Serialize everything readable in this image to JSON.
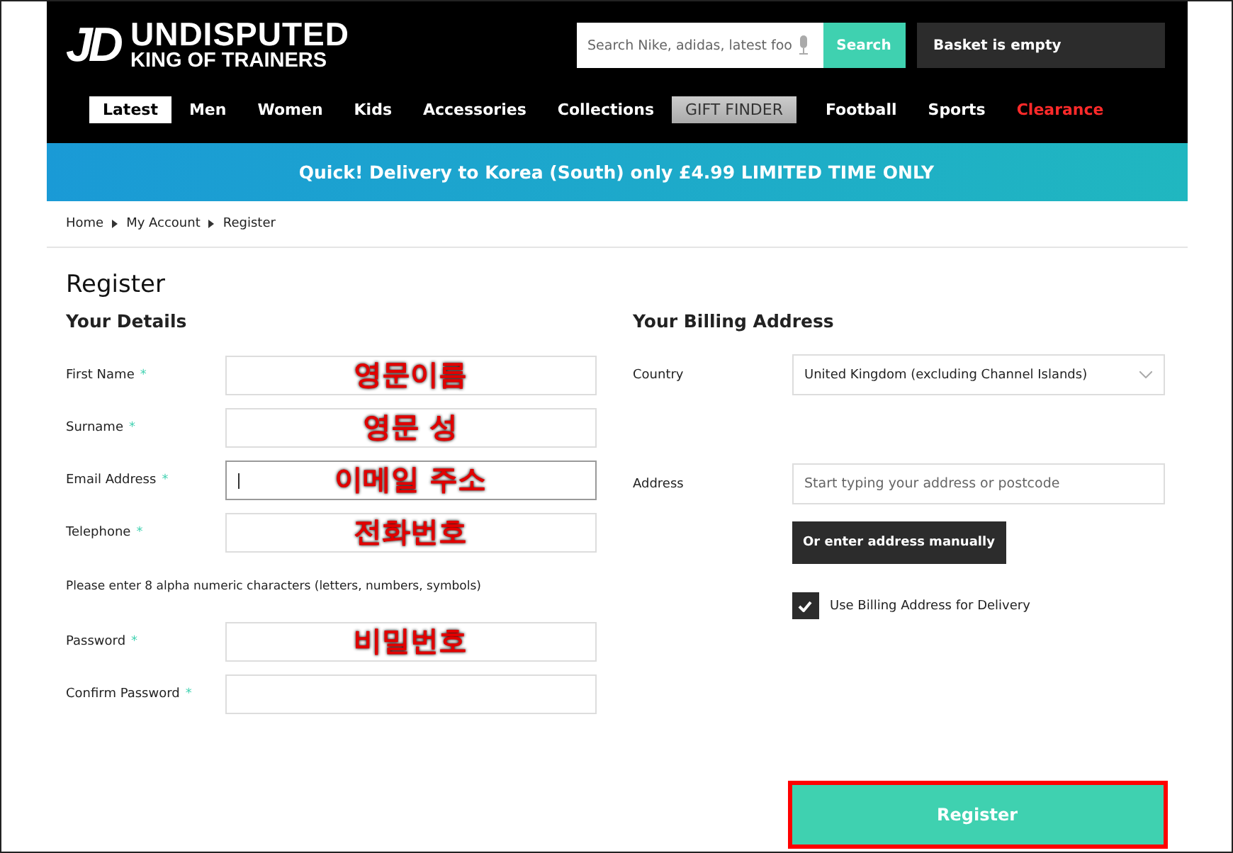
{
  "header": {
    "logo": {
      "mark": "JD",
      "line_1": "UNDISPUTED",
      "line_2": "KING OF TRAINERS"
    },
    "search": {
      "placeholder": "Search Nike, adidas, latest foo",
      "button": "Search"
    },
    "basket": "Basket is empty"
  },
  "nav": [
    {
      "label": "Latest",
      "selected": true,
      "kind": "plain"
    },
    {
      "label": "Men",
      "selected": false,
      "kind": "plain"
    },
    {
      "label": "Women",
      "selected": false,
      "kind": "plain"
    },
    {
      "label": "Kids",
      "selected": false,
      "kind": "plain"
    },
    {
      "label": "Accessories",
      "selected": false,
      "kind": "plain"
    },
    {
      "label": "Collections",
      "selected": false,
      "kind": "plain"
    },
    {
      "label": "GIFT FINDER",
      "selected": false,
      "kind": "gift"
    },
    {
      "label": "Football",
      "selected": false,
      "kind": "plain"
    },
    {
      "label": "Sports",
      "selected": false,
      "kind": "plain"
    },
    {
      "label": "Clearance",
      "selected": false,
      "kind": "sale"
    }
  ],
  "banner": "Quick! Delivery to Korea (South) only £4.99 LIMITED TIME ONLY",
  "breadcrumb": [
    "Home",
    "My Account",
    "Register"
  ],
  "title": "Register",
  "details": {
    "heading": "Your Details",
    "fields": [
      {
        "kind": "field",
        "label": "First Name",
        "required_mark": "*",
        "annotation": "영문이름",
        "focused": false
      },
      {
        "kind": "field",
        "label": "Surname",
        "required_mark": "*",
        "annotation": "영문 성",
        "focused": false
      },
      {
        "kind": "field",
        "label": "Email Address",
        "required_mark": "*",
        "annotation": "이메일 주소",
        "focused": true
      },
      {
        "kind": "field",
        "label": "Telephone",
        "required_mark": "*",
        "annotation": "전화번호",
        "focused": false
      },
      {
        "kind": "note",
        "text": "Please enter 8 alpha numeric characters (letters, numbers, symbols)"
      },
      {
        "kind": "field",
        "label": "Password",
        "required_mark": "*",
        "annotation": "비밀번호",
        "focused": false
      },
      {
        "kind": "field",
        "label": "Confirm Password",
        "required_mark": "*",
        "focused": false
      }
    ]
  },
  "billing": {
    "heading": "Your Billing Address",
    "country": {
      "label": "Country",
      "value": "United Kingdom (excluding Channel Islands)"
    },
    "address": {
      "label": "Address",
      "placeholder": "Start typing your address or postcode"
    },
    "manual_button": "Or enter address manually",
    "delivery_checkbox": {
      "label": "Use Billing Address for Delivery",
      "checked": true
    }
  },
  "register_button": {
    "label": "Register",
    "highlighted": true
  }
}
